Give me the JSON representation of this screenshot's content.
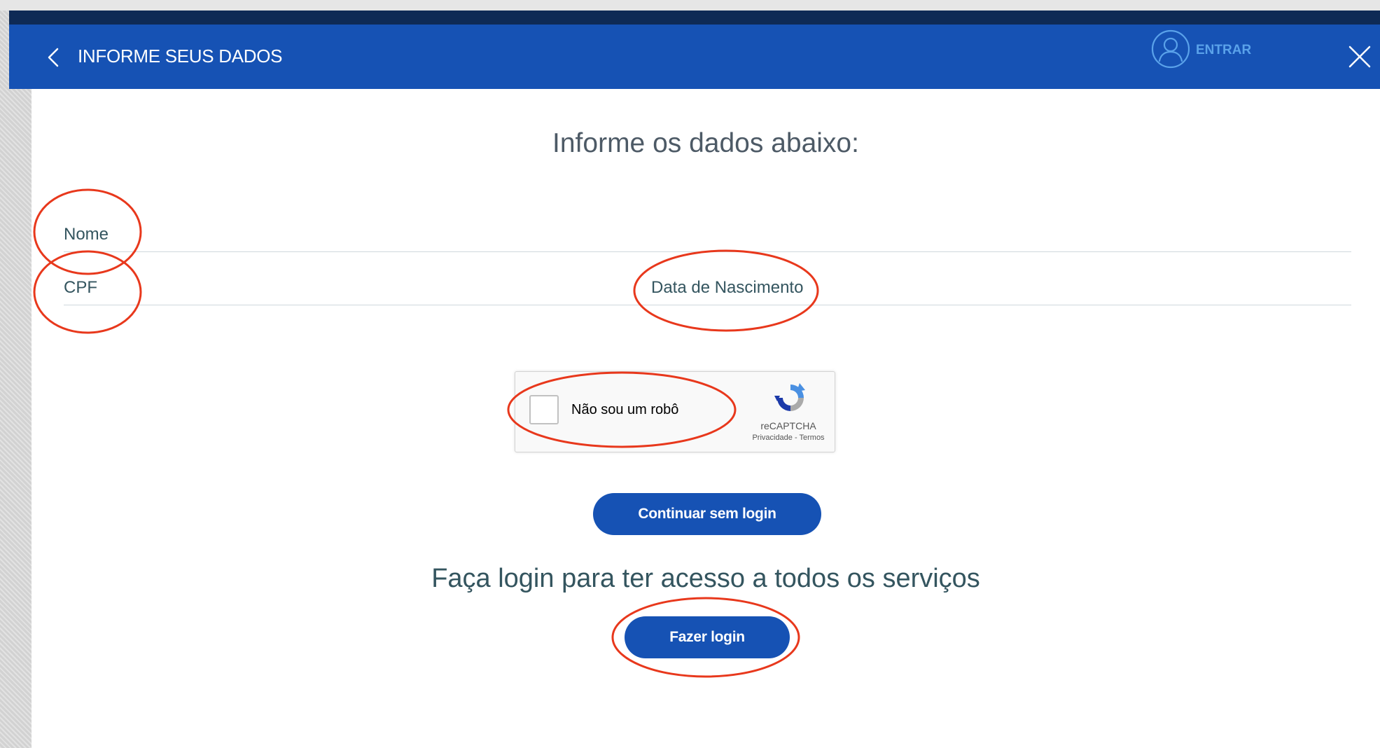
{
  "header": {
    "title": "INFORME SEUS DADOS",
    "enter_label": "ENTRAR",
    "icons": [
      "back-chevron-icon",
      "user-icon",
      "close-icon"
    ]
  },
  "form": {
    "subtitle": "Informe os dados abaixo:",
    "fields": {
      "name_label": "Nome",
      "cpf_label": "CPF",
      "birthdate_label": "Data de Nascimento"
    }
  },
  "captcha": {
    "label": "Não sou um robô",
    "brand": "reCAPTCHA",
    "privacy": "Privacidade",
    "separator": " - ",
    "terms": "Termos",
    "checked": false
  },
  "actions": {
    "continue_label": "Continuar sem login",
    "login_prompt": "Faça login para ter acesso a todos os serviços",
    "login_label": "Fazer login"
  },
  "colors": {
    "header_blue": "#1652b4",
    "dark_strip": "#0e2a55",
    "enter_text": "#5aa2ea",
    "annotation_red": "#e8381c",
    "label_text": "#34555f"
  }
}
